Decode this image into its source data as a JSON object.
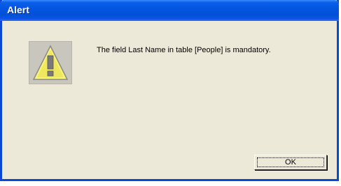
{
  "dialog": {
    "title": "Alert",
    "message": "The field Last Name in table [People] is mandatory.",
    "icon": "warning-icon",
    "ok_label": "OK"
  },
  "colors": {
    "title_bar": "#0455e1",
    "background": "#ece9d8",
    "warning_yellow": "#f5ef6a"
  }
}
